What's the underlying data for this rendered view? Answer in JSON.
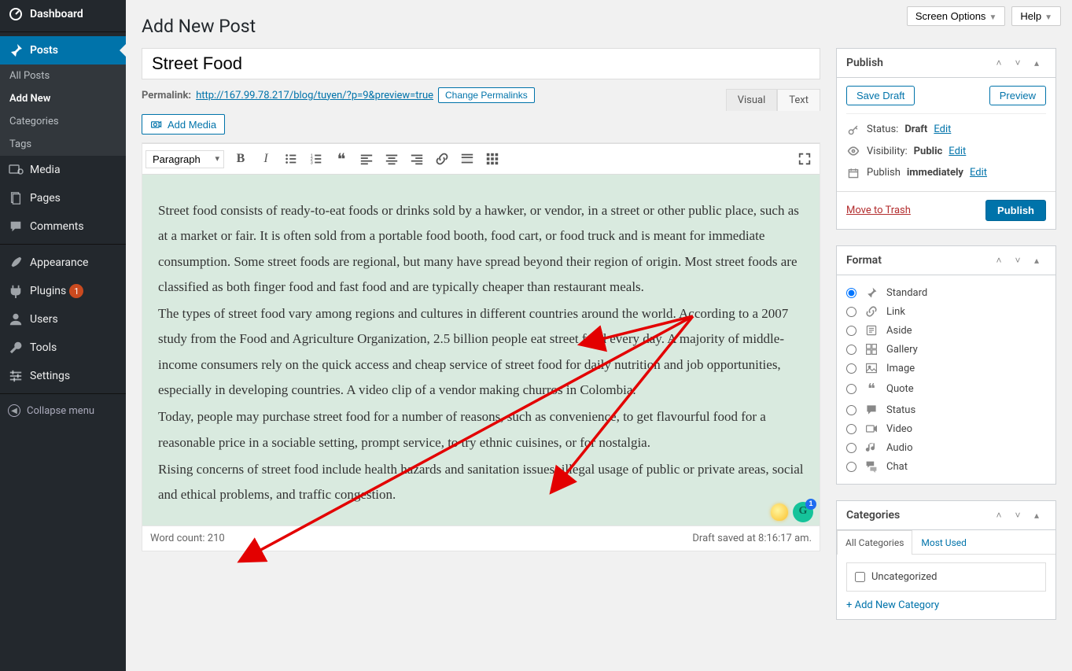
{
  "topbar": {
    "screen_options": "Screen Options",
    "help": "Help"
  },
  "sidebar": {
    "dashboard": "Dashboard",
    "posts": {
      "label": "Posts",
      "all": "All Posts",
      "add": "Add New",
      "cats": "Categories",
      "tags": "Tags"
    },
    "media": "Media",
    "pages": "Pages",
    "comments": "Comments",
    "appearance": "Appearance",
    "plugins": "Plugins",
    "plugins_badge": "1",
    "users": "Users",
    "tools": "Tools",
    "settings": "Settings",
    "collapse": "Collapse menu"
  },
  "page": {
    "title": "Add New Post"
  },
  "post": {
    "title": "Street Food",
    "permalink_label": "Permalink:",
    "permalink_url": "http://167.99.78.217/blog/tuyen/?p=9&preview=true",
    "change_permalinks": "Change Permalinks",
    "add_media": "Add Media",
    "tabs": {
      "visual": "Visual",
      "text": "Text"
    },
    "toolbar_style_selector": "Paragraph",
    "body_paragraphs": [
      "Street food consists of ready-to-eat foods or drinks sold by a hawker, or vendor, in a street or other public place, such as at a market or fair. It is often sold from a portable food booth, food cart, or food truck and is meant for immediate consumption. Some street foods are regional, but many have spread beyond their region of origin. Most street foods are classified as both finger food and fast food and are typically cheaper than restaurant meals.",
      "The types of street food vary among regions and cultures in different countries around the world. According to a 2007 study from the Food and Agriculture Organization, 2.5 billion people eat street food every day. A majority of middle-income consumers rely on the quick access and cheap service of street food for daily nutrition and job opportunities, especially in developing countries. A video clip of a vendor making churros in Colombia.",
      "Today, people may purchase street food for a number of reasons, such as convenience, to get flavourful food for a reasonable price in a sociable setting, prompt service, to try ethnic cuisines, or for nostalgia.",
      "Rising concerns of street food include health hazards and sanitation issues, illegal usage of public or private areas, social and ethical problems, and traffic congestion."
    ],
    "word_count_label": "Word count:",
    "word_count": "210",
    "draft_saved": "Draft saved at 8:16:17 am."
  },
  "publish": {
    "title": "Publish",
    "save_draft": "Save Draft",
    "preview": "Preview",
    "status_label": "Status:",
    "status_value": "Draft",
    "status_edit": "Edit",
    "visibility_label": "Visibility:",
    "visibility_value": "Public",
    "visibility_edit": "Edit",
    "schedule_label": "Publish",
    "schedule_value": "immediately",
    "schedule_edit": "Edit",
    "trash": "Move to Trash",
    "publish_btn": "Publish"
  },
  "format": {
    "title": "Format",
    "options": [
      "Standard",
      "Link",
      "Aside",
      "Gallery",
      "Image",
      "Quote",
      "Status",
      "Video",
      "Audio",
      "Chat"
    ],
    "selected": "Standard"
  },
  "categories": {
    "title": "Categories",
    "tab_all": "All Categories",
    "tab_most": "Most Used",
    "items": [
      "Uncategorized"
    ],
    "add_new": "+ Add New Category"
  }
}
